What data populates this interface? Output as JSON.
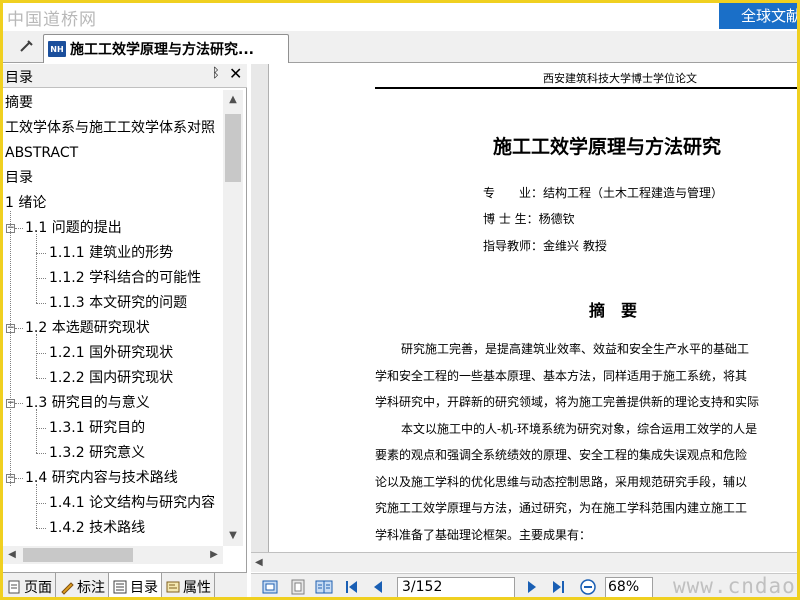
{
  "watermarks": {
    "top": "中国道桥网",
    "bottom": "www.cndao.com"
  },
  "header_button": {
    "label": "全球文献"
  },
  "document_tab": {
    "icon_text": "NH",
    "title": "施工工效学原理与方法研究..."
  },
  "outline_panel": {
    "title": "目录",
    "pin_glyph": "ᛒ",
    "close_glyph": "✕",
    "items": [
      {
        "label": "摘要",
        "level": 0
      },
      {
        "label": "工效学体系与施工工效学体系对照",
        "level": 0
      },
      {
        "label": "ABSTRACT",
        "level": 0
      },
      {
        "label": "目录",
        "level": 0
      },
      {
        "label": "1 绪论",
        "level": 0
      },
      {
        "label": "1.1 问题的提出",
        "level": 1
      },
      {
        "label": "1.1.1 建筑业的形势",
        "level": 2
      },
      {
        "label": "1.1.2 学科结合的可能性",
        "level": 2
      },
      {
        "label": "1.1.3 本文研究的问题",
        "level": 2
      },
      {
        "label": "1.2 本选题研究现状",
        "level": 1
      },
      {
        "label": "1.2.1 国外研究现状",
        "level": 2
      },
      {
        "label": "1.2.2 国内研究现状",
        "level": 2
      },
      {
        "label": "1.3 研究目的与意义",
        "level": 1
      },
      {
        "label": "1.3.1 研究目的",
        "level": 2
      },
      {
        "label": "1.3.2 研究意义",
        "level": 2
      },
      {
        "label": "1.4 研究内容与技术路线",
        "level": 1
      },
      {
        "label": "1.4.1 论文结构与研究内容",
        "level": 2
      },
      {
        "label": "1.4.2 技术路线",
        "level": 2
      }
    ],
    "tabs": [
      {
        "label": "页面",
        "icon": "page-icon"
      },
      {
        "label": "标注",
        "icon": "pen-icon"
      },
      {
        "label": "目录",
        "icon": "outline-icon"
      },
      {
        "label": "属性",
        "icon": "properties-icon"
      }
    ]
  },
  "document_page": {
    "running_header": "西安建筑科技大学博士学位论文",
    "title": "施工工效学原理与方法研究",
    "meta": [
      "专　　业：结构工程（土木工程建造与管理）",
      "博 士 生：杨德钦",
      "指导教师：金维兴  教授"
    ],
    "abstract_heading": "摘　要",
    "abstract_lines": [
      {
        "text": "研究施工完善，是提高建筑业效率、效益和安全生产水平的基础工",
        "indent": true
      },
      {
        "text": "学和安全工程的一些基本原理、基本方法，同样适用于施工系统，将其",
        "indent": false
      },
      {
        "text": "学科研究中，开辟新的研究领域，将为施工完善提供新的理论支持和实际",
        "indent": false
      },
      {
        "text": "本文以施工中的人-机-环境系统为研究对象，综合运用工效学的人是",
        "indent": true
      },
      {
        "text": "要素的观点和强调全系统绩效的原理、安全工程的集成失误观点和危险",
        "indent": false
      },
      {
        "text": "论以及施工学科的优化思维与动态控制思路，采用规范研究手段，辅以",
        "indent": false
      },
      {
        "text": "究施工工效学原理与方法，通过研究，为在施工学科范围内建立施工工",
        "indent": false
      },
      {
        "text": "学科准备了基础理论框架。主要成果有：",
        "indent": false
      }
    ]
  },
  "nav_bar": {
    "page_display": "3/152",
    "current_page": 3,
    "total_pages": 152,
    "zoom": "68%"
  }
}
